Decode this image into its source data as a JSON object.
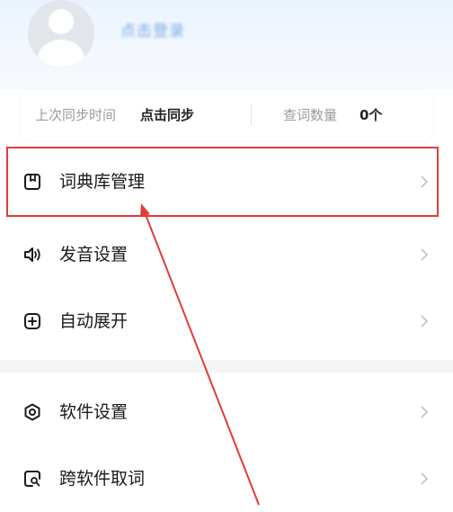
{
  "profile": {
    "username": "点击登录"
  },
  "sync": {
    "last_sync_label": "上次同步时间",
    "last_sync_value": "点击同步",
    "lookup_count_label": "查词数量",
    "lookup_count_value": "0个"
  },
  "menu": {
    "dictionary_management": "词典库管理",
    "pronunciation_settings": "发音设置",
    "auto_expand": "自动展开",
    "software_settings": "软件设置",
    "cross_app_lookup": "跨软件取词"
  },
  "colors": {
    "highlight": "#e23b3b",
    "header_bg": "#eaf3fd",
    "section_gap": "#f4f5f7"
  },
  "icons": {
    "dictionary": "book-bookmark-icon",
    "pronunciation": "speaker-icon",
    "auto_expand": "plus-square-icon",
    "settings": "settings-hexagon-icon",
    "lookup": "search-square-icon",
    "chevron": "chevron-right-icon"
  }
}
